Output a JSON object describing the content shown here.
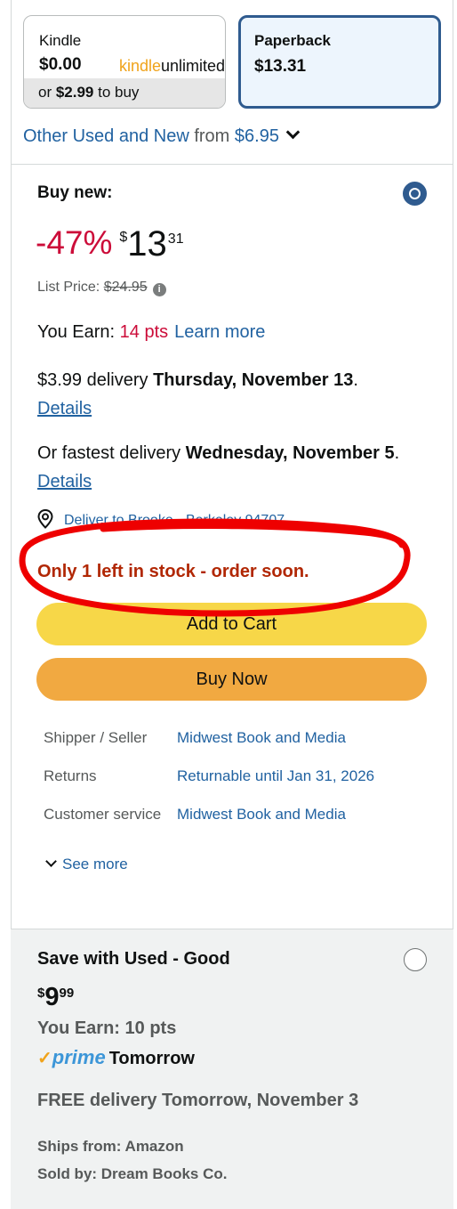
{
  "formats": {
    "kindle": {
      "name": "Kindle",
      "price": "$0.00",
      "ku_part1": "kindle",
      "ku_part2": "unlimited",
      "buy_prefix": "or ",
      "buy_price": "$2.99",
      "buy_suffix": " to buy"
    },
    "paperback": {
      "name": "Paperback",
      "price": "$13.31",
      "selected": true
    }
  },
  "other_used": {
    "label": "Other Used and New",
    "from": " from ",
    "price": "$6.95"
  },
  "buy_new": {
    "title": "Buy new:",
    "discount": "-47%",
    "currency": "$",
    "price_whole": "13",
    "price_fraction": "31",
    "list_price_label": "List Price: ",
    "list_price": "$24.95",
    "info_icon": "i",
    "earn_label": "You Earn: ",
    "earn_points": "14 pts",
    "learn_more": "Learn more",
    "delivery_prefix": "$3.99 delivery ",
    "delivery_date": "Thursday, November 13",
    "delivery_period": ". ",
    "details": "Details",
    "fastest_prefix": "Or fastest delivery ",
    "fastest_date": "Wednesday, November 5",
    "fastest_period": ". ",
    "deliver_to": "Deliver to Brooke - Berkeley 94707",
    "stock": "Only 1 left in stock - order soon.",
    "add_to_cart": "Add to Cart",
    "buy_now": "Buy Now"
  },
  "info_table": [
    {
      "label": "Shipper / Seller",
      "value": "Midwest Book and Media"
    },
    {
      "label": "Returns",
      "value": "Returnable until Jan 31, 2026"
    },
    {
      "label": "Customer service",
      "value": "Midwest Book and Media"
    }
  ],
  "see_more": "See more",
  "used": {
    "title": "Save with Used - Good",
    "currency": "$",
    "price_whole": "9",
    "price_fraction": "99",
    "earn": "You Earn: 10 pts",
    "prime_check": "✓",
    "prime_word": "prime",
    "prime_day": "Tomorrow",
    "delivery": "FREE delivery Tomorrow, November 3",
    "ships_from": "Ships from: Amazon",
    "sold_by": "Sold by: Dream Books Co."
  },
  "colors": {
    "link": "#2162a1",
    "deal_red": "#cc0c39",
    "stock_red": "#b12704",
    "cart_yellow": "#f7d748",
    "buy_orange": "#f1a941",
    "selected_border": "#2f5b8f",
    "annotation_red": "#ee0000"
  }
}
